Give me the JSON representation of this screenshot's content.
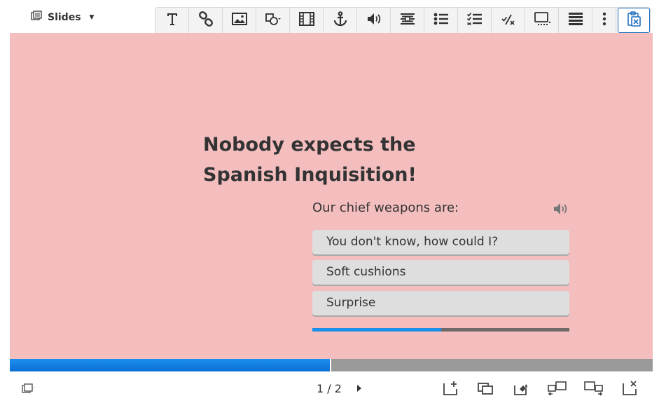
{
  "topbar": {
    "menu_label": "Slides",
    "menu_icon": "slides-icon",
    "tools": [
      {
        "name": "text-tool",
        "icon": "text-icon"
      },
      {
        "name": "link-tool",
        "icon": "link-icon"
      },
      {
        "name": "image-tool",
        "icon": "image-icon"
      },
      {
        "name": "shapes-tool",
        "icon": "shapes-icon"
      },
      {
        "name": "video-tool",
        "icon": "video-icon"
      },
      {
        "name": "anchor-tool",
        "icon": "anchor-icon"
      },
      {
        "name": "audio-tool",
        "icon": "speaker-icon"
      },
      {
        "name": "fill-in-tool",
        "icon": "fill-in-icon"
      },
      {
        "name": "single-choice-tool",
        "icon": "single-choice-icon"
      },
      {
        "name": "multi-choice-tool",
        "icon": "multi-choice-icon"
      },
      {
        "name": "true-false-tool",
        "icon": "true-false-icon"
      },
      {
        "name": "summary-tool",
        "icon": "summary-icon"
      },
      {
        "name": "table-tool",
        "icon": "table-icon"
      },
      {
        "name": "more-tool",
        "icon": "more-vertical-icon"
      },
      {
        "name": "paste-tool",
        "icon": "clipboard-icon",
        "active": true
      }
    ]
  },
  "slide": {
    "background": "#f4bebe",
    "title_line1": "Nobody expects the",
    "title_line2": "Spanish Inquisition!",
    "question": "Our chief weapons are:",
    "answers": [
      "You don't know, how could I?",
      "Soft cushions",
      "Surprise"
    ],
    "question_progress": 0.5
  },
  "presentation": {
    "progress": 0.5,
    "current_slide": "1",
    "total_slides": "2",
    "counter_separator": "/"
  },
  "colors": {
    "accent": "#1a8fe8",
    "progress_track": "#9a9a9a",
    "answer_bg": "#dedede"
  }
}
